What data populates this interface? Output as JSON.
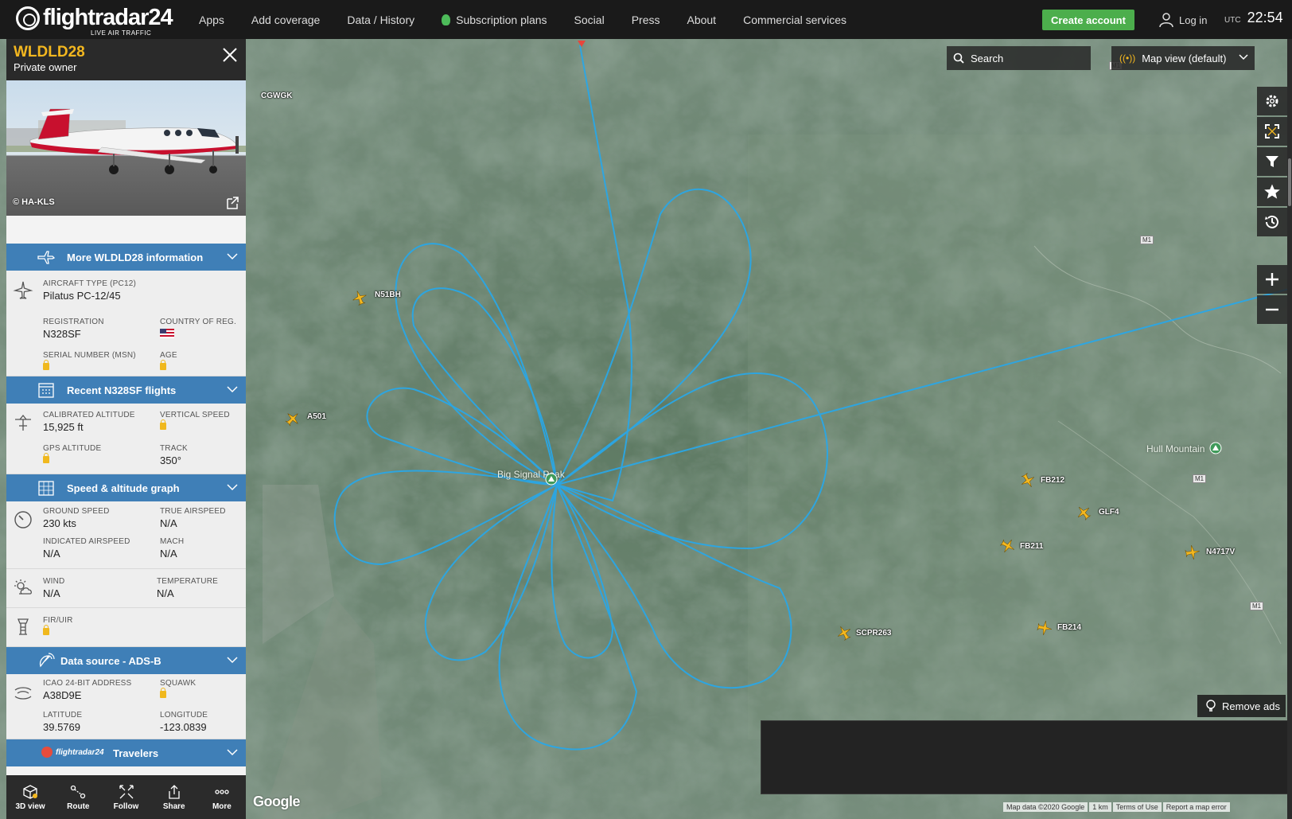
{
  "topbar": {
    "brand": "flightradar24",
    "brand_sub": "LIVE AIR TRAFFIC",
    "nav": [
      "Apps",
      "Add coverage",
      "Data / History",
      "Subscription plans",
      "Social",
      "Press",
      "About",
      "Commercial services"
    ],
    "create_account": "Create account",
    "login": "Log in",
    "utc_label": "UTC",
    "time": "22:54"
  },
  "panel": {
    "callsign": "WLDLD28",
    "owner": "Private owner",
    "photo_credit": "© HA-KLS",
    "sections": {
      "more_info": "More WLDLD28 information",
      "recent_flights": "Recent N328SF flights",
      "speed_graph": "Speed & altitude graph",
      "data_source": "Data source - ADS-B",
      "travelers": "Travelers",
      "travelers_brand": "flightradar24"
    },
    "aircraft_type_label": "AIRCRAFT TYPE",
    "aircraft_type_code": "(PC12)",
    "aircraft_type": "Pilatus PC-12/45",
    "registration_label": "REGISTRATION",
    "registration": "N328SF",
    "country_label": "COUNTRY OF REG.",
    "msn_label": "SERIAL NUMBER (MSN)",
    "age_label": "AGE",
    "cal_alt_label": "CALIBRATED ALTITUDE",
    "cal_alt": "15,925 ft",
    "vspeed_label": "VERTICAL SPEED",
    "gps_alt_label": "GPS ALTITUDE",
    "track_label": "TRACK",
    "track": "350°",
    "ground_speed_label": "GROUND SPEED",
    "ground_speed": "230 kts",
    "tas_label": "TRUE AIRSPEED",
    "tas": "N/A",
    "ias_label": "INDICATED AIRSPEED",
    "ias": "N/A",
    "mach_label": "MACH",
    "mach": "N/A",
    "wind_label": "WIND",
    "wind": "N/A",
    "temp_label": "TEMPERATURE",
    "temp": "N/A",
    "fir_label": "FIR/UIR",
    "icao_label": "ICAO 24-BIT ADDRESS",
    "icao": "A38D9E",
    "squawk_label": "SQUAWK",
    "lat_label": "LATITUDE",
    "lat": "39.5769",
    "lon_label": "LONGITUDE",
    "lon": "-123.0839"
  },
  "bottom_bar": [
    "3D view",
    "Route",
    "Follow",
    "Share",
    "More"
  ],
  "map": {
    "search_placeholder": "Search",
    "map_view": "Map view (default)",
    "remove_ads": "Remove ads",
    "google": "Google",
    "attribution": [
      "Map data ©2020 Google",
      "1 km",
      "Terms of Use",
      "Report a map error"
    ],
    "places": {
      "peak": "Big Signal Peak",
      "mountain": "Hull Mountain"
    },
    "aircraft": [
      "CGWGK",
      "N51BH",
      "A501",
      "FB212",
      "GLF4",
      "FB211",
      "N4717V",
      "FB214",
      "SCPR263"
    ],
    "roads": [
      "M1",
      "M1",
      "M1",
      "M1"
    ],
    "track_color": "#2aa7e6"
  },
  "colors": {
    "accent_blue": "#3f7fb7",
    "callsign_yellow": "#f3b71f",
    "create_green": "#4cae4c"
  }
}
